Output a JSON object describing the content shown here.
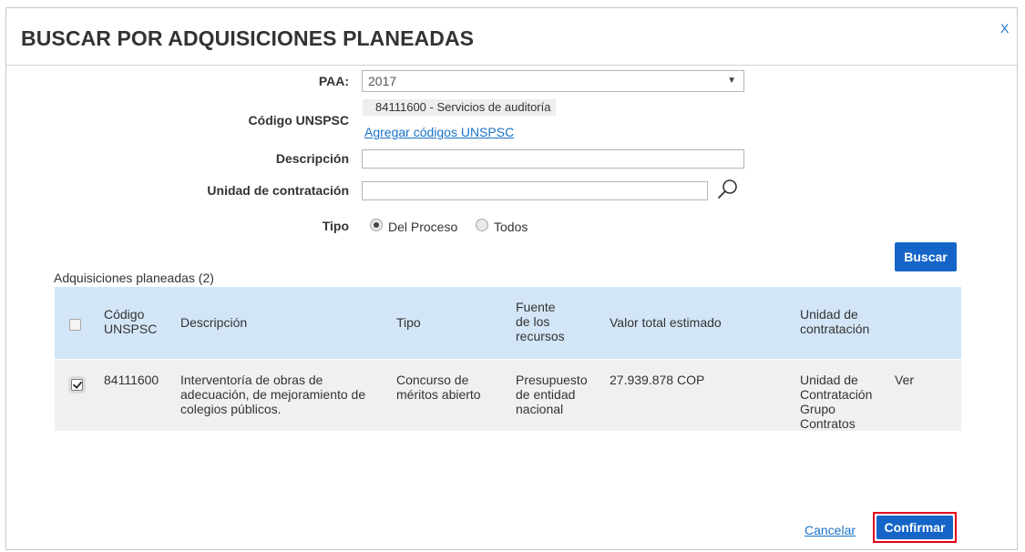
{
  "dialog": {
    "title": "BUSCAR POR ADQUISICIONES PLANEADAS",
    "close_label": "X"
  },
  "form": {
    "paa_label": "PAA:",
    "paa_value": "2017",
    "unspsc_label": "Código UNSPSC",
    "unspsc_chip": "84111600 - Servicios de auditoría",
    "unspsc_add_link": "Agregar códigos UNSPSC",
    "descripcion_label": "Descripción",
    "descripcion_value": "",
    "unidad_label": "Unidad de contratación",
    "unidad_value": "",
    "tipo_label": "Tipo",
    "tipo_options": [
      {
        "label": "Del Proceso",
        "selected": true
      },
      {
        "label": "Todos",
        "selected": false
      }
    ],
    "search_button": "Buscar"
  },
  "results": {
    "section_title": "Adquisiciones planeadas (2)",
    "columns": {
      "codigo": "Código UNSPSC",
      "descripcion": "Descripción",
      "tipo": "Tipo",
      "fuente": "Fuente de los recursos",
      "valor": "Valor total estimado",
      "unidad": "Unidad de contratación"
    },
    "rows": [
      {
        "checked": true,
        "codigo": "84111600",
        "descripcion": "Interventoría de obras de adecuación, de mejoramiento de colegios públicos.",
        "tipo": "Concurso de méritos abierto",
        "fuente": "Presupuesto de entidad nacional",
        "valor": "27.939.878 COP",
        "unidad": "Unidad de Contratación Grupo Contratos",
        "action": "Ver"
      }
    ]
  },
  "footer": {
    "cancel_label": "Cancelar",
    "confirm_label": "Confirmar"
  },
  "colors": {
    "primary": "#1565c8",
    "link": "#1a73c7",
    "table_header_bg": "#d3e6f7",
    "highlight_border": "#e3001b"
  },
  "icons": {
    "select_arrow": "chevron-down-icon",
    "search": "search-icon"
  }
}
